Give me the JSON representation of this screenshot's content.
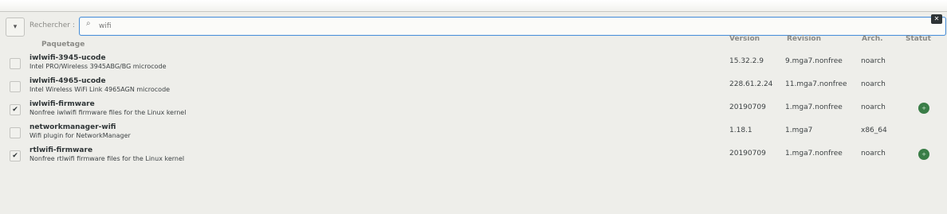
{
  "search": {
    "menu_icon": "dropdown-arrow",
    "label": "Rechercher :",
    "value": "wifi",
    "search_icon": "magnifier",
    "clear_icon": "backspace-clear"
  },
  "columns": {
    "package": "Paquetage",
    "version": "Version",
    "revision": "Révision",
    "arch": "Arch.",
    "status": "Statut"
  },
  "rows": [
    {
      "name": "iwlwifi-3945-ucode",
      "desc": "Intel PRO/Wireless 3945ABG/BG microcode",
      "version": "15.32.2.9",
      "revision": "9.mga7.nonfree",
      "arch": "noarch",
      "checked": "",
      "status": ""
    },
    {
      "name": "iwlwifi-4965-ucode",
      "desc": "Intel Wireless WiFi Link 4965AGN microcode",
      "version": "228.61.2.24",
      "revision": "11.mga7.nonfree",
      "arch": "noarch",
      "checked": "",
      "status": ""
    },
    {
      "name": "iwlwifi-firmware",
      "desc": "Nonfree iwlwifi firmware files for the Linux kernel",
      "version": "20190709",
      "revision": "1.mga7.nonfree",
      "arch": "noarch",
      "checked": "✔",
      "status": "+"
    },
    {
      "name": "networkmanager-wifi",
      "desc": "Wifi plugin for NetworkManager",
      "version": "1.18.1",
      "revision": "1.mga7",
      "arch": "x86_64",
      "checked": "",
      "status": ""
    },
    {
      "name": "rtlwifi-firmware",
      "desc": "Nonfree rtlwifi firmware files for the Linux kernel",
      "version": "20190709",
      "revision": "1.mga7.nonfree",
      "arch": "noarch",
      "checked": "✔",
      "status": "+"
    }
  ],
  "colors": {
    "accent": "#4a90d9",
    "installed": "#3a7d47"
  }
}
